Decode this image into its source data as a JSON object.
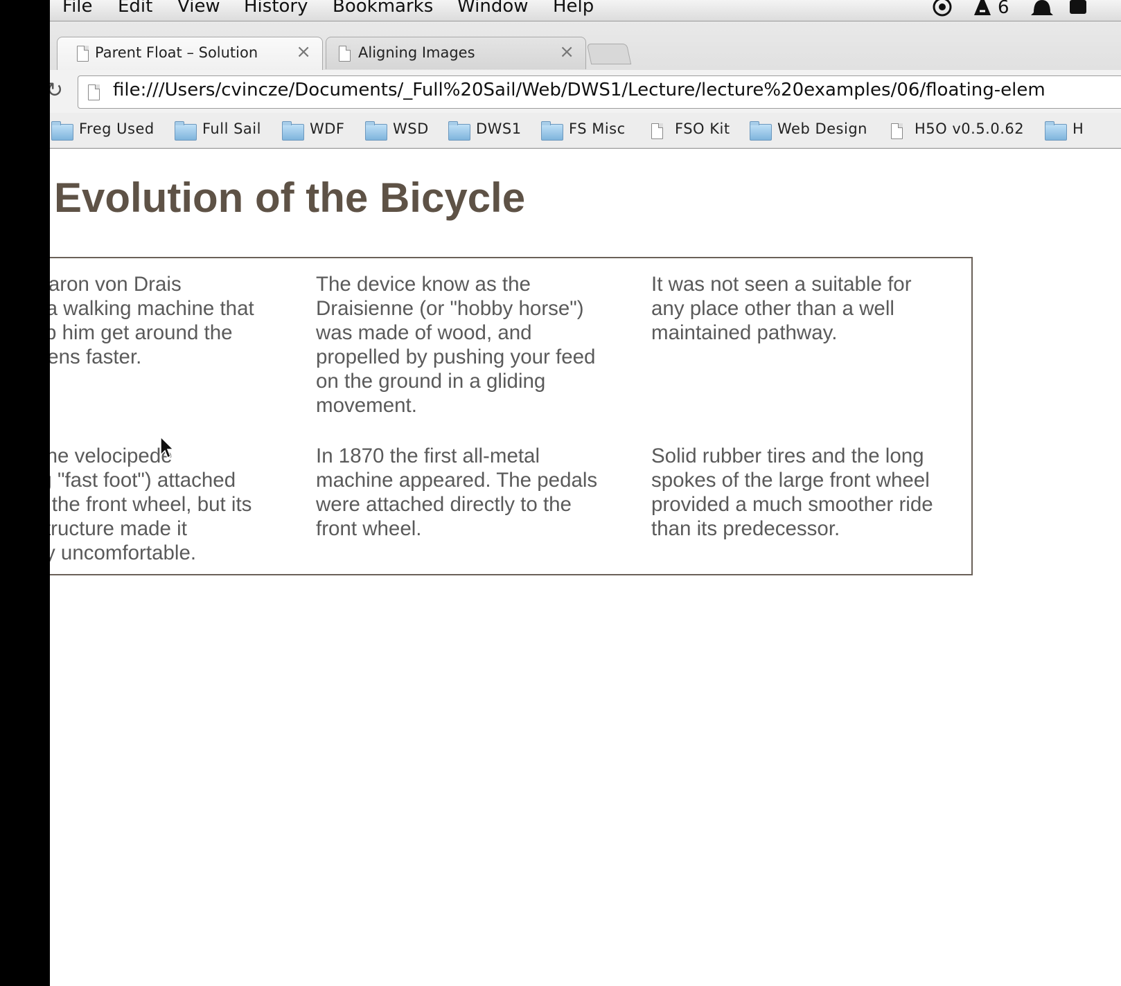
{
  "menubar": {
    "items": [
      "File",
      "Edit",
      "View",
      "History",
      "Bookmarks",
      "Window",
      "Help"
    ],
    "tray_text": "6"
  },
  "tabs": [
    {
      "label": "Parent Float – Solution",
      "active": true
    },
    {
      "label": "Aligning Images",
      "active": false
    }
  ],
  "address_bar": {
    "url": "file:///Users/cvincze/Documents/_Full%20Sail/Web/DWS1/Lecture/lecture%20examples/06/floating-elem"
  },
  "bookmarks": [
    {
      "label": "Freg Used",
      "icon": "folder-icon"
    },
    {
      "label": "Full Sail",
      "icon": "folder-icon"
    },
    {
      "label": "WDF",
      "icon": "folder-icon"
    },
    {
      "label": "WSD",
      "icon": "folder-icon"
    },
    {
      "label": "DWS1",
      "icon": "folder-icon"
    },
    {
      "label": "FS Misc",
      "icon": "folder-icon"
    },
    {
      "label": "FSO Kit",
      "icon": "page-icon"
    },
    {
      "label": "Web Design",
      "icon": "folder-icon"
    },
    {
      "label": "H5O v0.5.0.62",
      "icon": "page-icon"
    },
    {
      "label": "H",
      "icon": "folder-icon"
    }
  ],
  "page": {
    "title": "Evolution of the Bicycle",
    "cells": [
      " Baron von Drais\nd a walking machine that\nelp him get around the\nrdens faster.",
      "The device know as the\nDraisienne (or \"hobby horse\")\nwas made of wood, and\npropelled by pushing your feed\non the ground in a gliding\nmovement.",
      "It was not seen a suitable for\nany place other than a well\nmaintained pathway.",
      ", the velocipede\nng \"fast foot\") attached\nto the front wheel, but its\n structure made it\nely uncomfortable.",
      "In 1870 the first all-metal\nmachine appeared. The pedals\nwere attached directly to the\nfront wheel.",
      "Solid rubber tires and the long\nspokes of the large front wheel\nprovided a much smoother ride\nthan its predecessor."
    ]
  },
  "colors": {
    "heading": "#5e5246",
    "body_text": "#5a5a5a",
    "parent_border": "#6a6058"
  }
}
